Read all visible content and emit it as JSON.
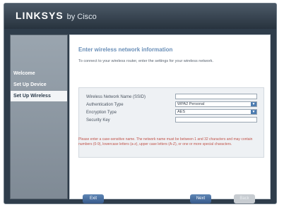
{
  "app": {
    "logo": "LINKSYS",
    "logo_suffix": "by Cisco"
  },
  "sidebar": {
    "items": [
      {
        "label": "Welcome"
      },
      {
        "label": "Set Up Device"
      },
      {
        "label": "Set Up Wireless"
      }
    ]
  },
  "main": {
    "heading": "Enter wireless network information",
    "intro": "To connect to your wireless router, enter the settings for your wireless network.",
    "fields": [
      {
        "label": "Wireless Network Name (SSID)",
        "value": ""
      },
      {
        "label": "Authentication Type",
        "value": "WPA2 Personal"
      },
      {
        "label": "Encryption Type",
        "value": "AES"
      },
      {
        "label": "Security Key",
        "value": ""
      }
    ],
    "note": "Please enter a case-sensitive name. The network name must be between 1 and 32 characters and may contain numbers (0-9), lowercase letters (a-z), upper case letters (A-Z), or one or more special characters."
  },
  "buttons": {
    "exit": "Exit",
    "next": "Next",
    "back": "Back"
  }
}
